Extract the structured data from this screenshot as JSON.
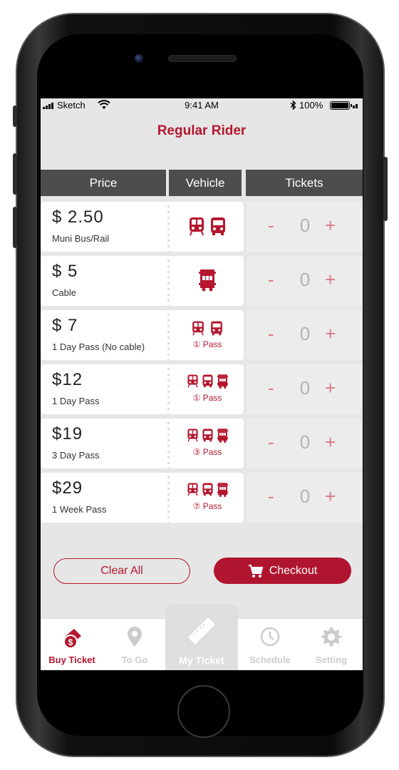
{
  "status": {
    "carrier": "Sketch",
    "time": "9:41 AM",
    "battery": "100%"
  },
  "title": "Regular Rider",
  "headers": {
    "price": "Price",
    "vehicle": "Vehicle",
    "tickets": "Tickets"
  },
  "rows": [
    {
      "price": "$ 2.50",
      "desc": "Muni Bus/Rail",
      "icons": [
        "train-icon",
        "bus-icon"
      ],
      "pass": "",
      "count": "0"
    },
    {
      "price": "$ 5",
      "desc": "Cable",
      "icons": [
        "cable-car-icon"
      ],
      "pass": "",
      "count": "0"
    },
    {
      "price": "$ 7",
      "desc": "1 Day Pass (No cable)",
      "icons": [
        "train-icon",
        "bus-icon"
      ],
      "pass": "① Pass",
      "count": "0"
    },
    {
      "price": "$12",
      "desc": "1 Day Pass",
      "icons": [
        "train-icon",
        "bus-icon",
        "cable-car-icon"
      ],
      "pass": "① Pass",
      "count": "0"
    },
    {
      "price": "$19",
      "desc": "3 Day Pass",
      "icons": [
        "train-icon",
        "bus-icon",
        "cable-car-icon"
      ],
      "pass": "③ Pass",
      "count": "0"
    },
    {
      "price": "$29",
      "desc": "1 Week Pass",
      "icons": [
        "train-icon",
        "bus-icon",
        "cable-car-icon"
      ],
      "pass": "⑦ Pass",
      "count": "0"
    }
  ],
  "stepper": {
    "minus": "-",
    "plus": "+"
  },
  "buttons": {
    "clear": "Clear All",
    "checkout": "Checkout"
  },
  "tabs": {
    "buy": "Buy Ticket",
    "togo": "To Go",
    "my": "My Ticket",
    "schedule": "Schedule",
    "setting": "Setting"
  },
  "colors": {
    "brand": "#b5172f",
    "header_bg": "#4d4d4d",
    "screen_bg": "#e6e6e6",
    "stepper": "#d97a88",
    "inactive_tab": "#cccccc"
  }
}
